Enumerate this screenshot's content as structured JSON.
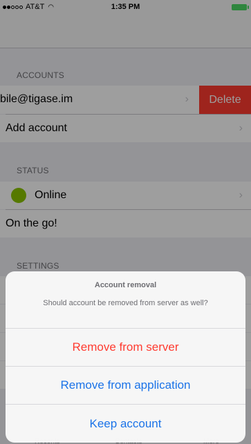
{
  "status_bar": {
    "carrier": "AT&T",
    "time": "1:35 PM",
    "battery_color": "#4cd964"
  },
  "accounts": {
    "header": "ACCOUNTS",
    "account_label": "bile@tigase.im",
    "delete_label": "Delete",
    "add_label": "Add account"
  },
  "status": {
    "header": "STATUS",
    "presence": "Online",
    "presence_color": "#8bc400",
    "message": "On the go!"
  },
  "settings": {
    "header": "SETTINGS"
  },
  "tabbar": {
    "items": [
      "Recents",
      "Contacts",
      "More"
    ]
  },
  "sheet": {
    "title": "Account removal",
    "message": "Should account be removed from server as well?",
    "remove_server": "Remove from server",
    "remove_app": "Remove from application",
    "keep": "Keep account"
  }
}
